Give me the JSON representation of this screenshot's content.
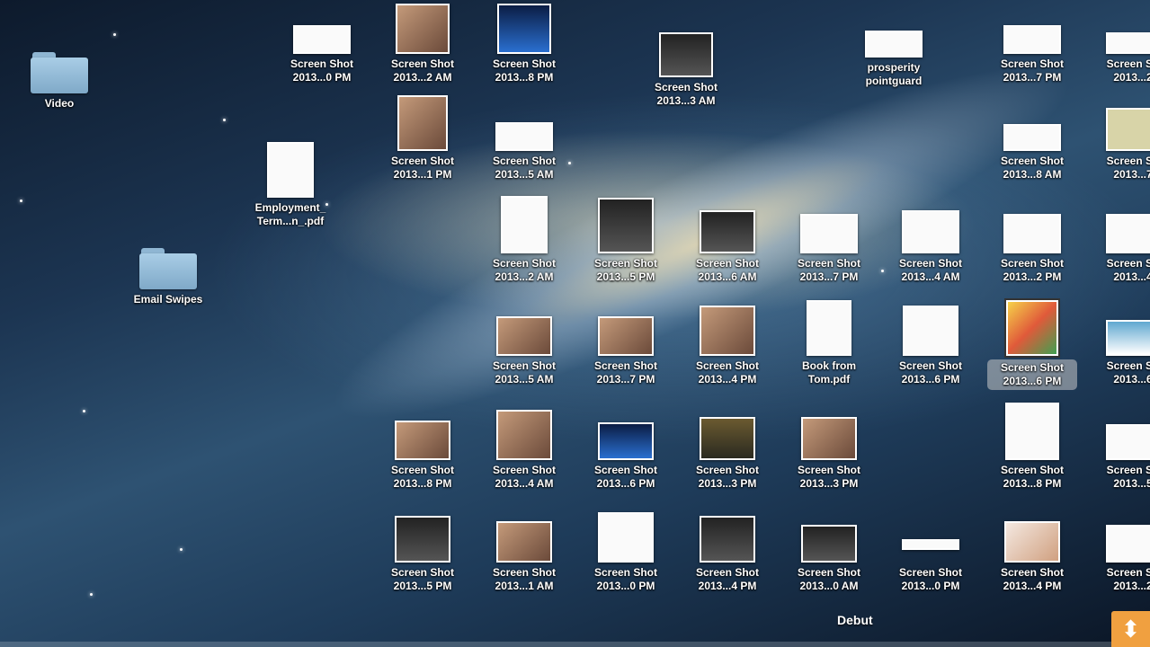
{
  "desktop": {
    "folders": [
      {
        "label": "Video"
      },
      {
        "label": "Email Swipes"
      }
    ],
    "files": [
      {
        "l1": "Screen Shot",
        "l2": "2013...0 PM"
      },
      {
        "l1": "Screen Shot",
        "l2": "2013...2 AM"
      },
      {
        "l1": "Screen Shot",
        "l2": "2013...8 PM"
      },
      {
        "l1": "Screen Shot",
        "l2": "2013...3 AM"
      },
      {
        "l1": "prosperity",
        "l2": "pointguard"
      },
      {
        "l1": "Screen Shot",
        "l2": "2013...7 PM"
      },
      {
        "l1": "Screen Sh",
        "l2": "2013...2"
      },
      {
        "l1": "Screen Shot",
        "l2": "2013...1 PM"
      },
      {
        "l1": "Screen Shot",
        "l2": "2013...5 AM"
      },
      {
        "l1": "Screen Shot",
        "l2": "2013...8 AM"
      },
      {
        "l1": "Screen Sh",
        "l2": "2013...7"
      },
      {
        "l1": "Employment_",
        "l2": "Term...n_.pdf"
      },
      {
        "l1": "Screen Shot",
        "l2": "2013...2 AM"
      },
      {
        "l1": "Screen Shot",
        "l2": "2013...5 PM"
      },
      {
        "l1": "Screen Shot",
        "l2": "2013...6 AM"
      },
      {
        "l1": "Screen Shot",
        "l2": "2013...7 PM"
      },
      {
        "l1": "Screen Shot",
        "l2": "2013...4 AM"
      },
      {
        "l1": "Screen Shot",
        "l2": "2013...2 PM"
      },
      {
        "l1": "Screen Sh",
        "l2": "2013...4"
      },
      {
        "l1": "Screen Shot",
        "l2": "2013...5 AM"
      },
      {
        "l1": "Screen Shot",
        "l2": "2013...7 PM"
      },
      {
        "l1": "Screen Shot",
        "l2": "2013...4 PM"
      },
      {
        "l1": "Book from",
        "l2": "Tom.pdf"
      },
      {
        "l1": "Screen Shot",
        "l2": "2013...6 PM"
      },
      {
        "l1": "Screen Shot",
        "l2": "2013...6 PM"
      },
      {
        "l1": "Screen Sh",
        "l2": "2013...6"
      },
      {
        "l1": "Screen Shot",
        "l2": "2013...8 PM"
      },
      {
        "l1": "Screen Shot",
        "l2": "2013...4 AM"
      },
      {
        "l1": "Screen Shot",
        "l2": "2013...6 PM"
      },
      {
        "l1": "Screen Shot",
        "l2": "2013...3 PM"
      },
      {
        "l1": "Screen Shot",
        "l2": "2013...3 PM"
      },
      {
        "l1": "Screen Shot",
        "l2": "2013...8 PM"
      },
      {
        "l1": "Screen Sh",
        "l2": "2013...5"
      },
      {
        "l1": "Screen Shot",
        "l2": "2013...5 PM"
      },
      {
        "l1": "Screen Shot",
        "l2": "2013...1 AM"
      },
      {
        "l1": "Screen Shot",
        "l2": "2013...0 PM"
      },
      {
        "l1": "Screen Shot",
        "l2": "2013...4 PM"
      },
      {
        "l1": "Screen Shot",
        "l2": "2013...0 AM"
      },
      {
        "l1": "Screen Shot",
        "l2": "2013...0 PM"
      },
      {
        "l1": "Screen Shot",
        "l2": "2013...4 PM"
      },
      {
        "l1": "Screen Sh",
        "l2": "2013...2"
      }
    ]
  },
  "dock": {
    "tooltip": "Debut",
    "usb_icon": "usb-icon"
  }
}
